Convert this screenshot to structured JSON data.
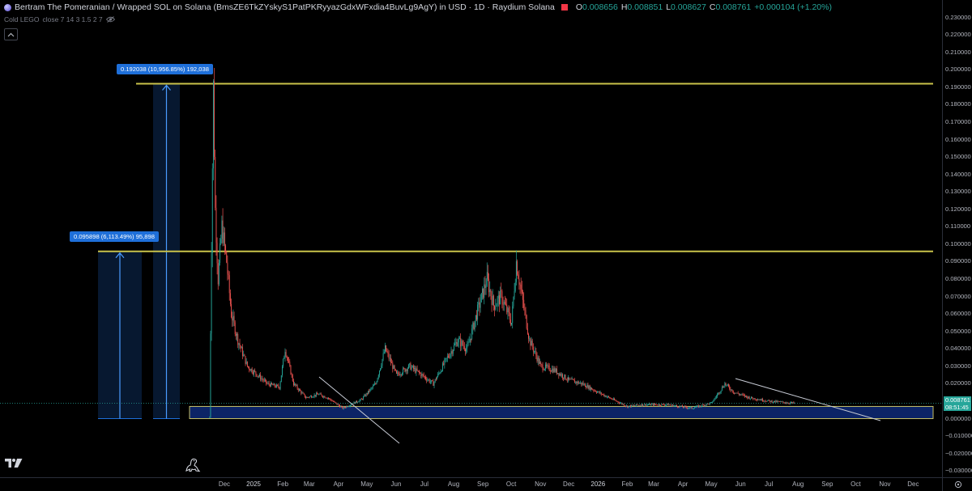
{
  "legend": {
    "title": "Bertram The Pomeranian / Wrapped SOL on Solana (BmsZE6TkZYskyS1PatPKRyyazGdxWFxdia4BuvLg9AgY) in USD · 1D · Raydium Solana",
    "open_key": "O",
    "open": "0.008656",
    "high_key": "H",
    "high": "0.008851",
    "low_key": "L",
    "low": "0.008627",
    "close_key": "C",
    "close": "0.008761",
    "change": "+0.000104 (+1.20%)",
    "flag_color": "#f23645",
    "icon": "token-logo-icon"
  },
  "indicator": {
    "name": "Cold LEGO",
    "params": "close 7 14 3 1.5 2 7",
    "visibility_icon": "eye-icon"
  },
  "colors": {
    "up": "#26a69a",
    "down": "#ef5350",
    "level_line": "#c9c24a",
    "measure_blue": "#1e6fd9",
    "zone_fill": "#0c2466",
    "trendline": "#c8ccd6"
  },
  "measurements": [
    {
      "label": "0.192038 (10,956.85%) 192,038"
    },
    {
      "label": "0.095898 (6,113.49%) 95,898"
    }
  ],
  "price_axis": {
    "ticks": [
      "0.230000",
      "0.220000",
      "0.210000",
      "0.200000",
      "0.190000",
      "0.180000",
      "0.170000",
      "0.160000",
      "0.150000",
      "0.140000",
      "0.130000",
      "0.120000",
      "0.110000",
      "0.100000",
      "0.090000",
      "0.080000",
      "0.070000",
      "0.060000",
      "0.050000",
      "0.040000",
      "0.030000",
      "0.020000",
      "0.010000",
      "0.000000",
      "−0.010000",
      "−0.020000",
      "−0.030000"
    ],
    "last_price": "0.008761",
    "countdown": "08:51:45"
  },
  "time_axis": {
    "ticks": [
      "Dec",
      "2025",
      "Feb",
      "Mar",
      "Apr",
      "May",
      "Jun",
      "Jul",
      "Aug",
      "Sep",
      "Oct",
      "Nov",
      "Dec",
      "2026",
      "Feb",
      "Mar",
      "Apr",
      "May",
      "Jun",
      "Jul",
      "Aug",
      "Sep",
      "Oct",
      "Nov",
      "Dec"
    ]
  },
  "chart_data": {
    "type": "candlestick",
    "title": "Bertram The Pomeranian / Wrapped SOL on Solana (BmsZE6TkZYskyS1PatPKRyyazGdxWFxdia4BuvLg9AgY) in USD · 1D · Raydium Solana",
    "x_start": "2024-11-15",
    "x_end": "2026-12-31",
    "interval": "1D",
    "ylim": [
      -0.03,
      0.235
    ],
    "price_anchors": [
      [
        "2024-11-15",
        0.0007
      ],
      [
        "2024-11-17",
        0.1
      ],
      [
        "2024-11-19",
        0.19
      ],
      [
        "2024-11-21",
        0.12
      ],
      [
        "2024-11-24",
        0.08
      ],
      [
        "2024-11-28",
        0.11
      ],
      [
        "2024-12-03",
        0.09
      ],
      [
        "2024-12-08",
        0.06
      ],
      [
        "2024-12-15",
        0.045
      ],
      [
        "2024-12-25",
        0.03
      ],
      [
        "2025-01-05",
        0.025
      ],
      [
        "2025-01-15",
        0.02
      ],
      [
        "2025-01-28",
        0.018
      ],
      [
        "2025-02-03",
        0.04
      ],
      [
        "2025-02-12",
        0.02
      ],
      [
        "2025-02-25",
        0.012
      ],
      [
        "2025-03-10",
        0.014
      ],
      [
        "2025-03-20",
        0.012
      ],
      [
        "2025-04-05",
        0.006
      ],
      [
        "2025-04-25",
        0.011
      ],
      [
        "2025-05-10",
        0.02
      ],
      [
        "2025-05-20",
        0.04
      ],
      [
        "2025-06-01",
        0.025
      ],
      [
        "2025-06-15",
        0.03
      ],
      [
        "2025-06-28",
        0.025
      ],
      [
        "2025-07-10",
        0.02
      ],
      [
        "2025-07-25",
        0.035
      ],
      [
        "2025-08-05",
        0.045
      ],
      [
        "2025-08-15",
        0.04
      ],
      [
        "2025-08-25",
        0.06
      ],
      [
        "2025-09-05",
        0.08
      ],
      [
        "2025-09-12",
        0.065
      ],
      [
        "2025-09-20",
        0.07
      ],
      [
        "2025-10-01",
        0.055
      ],
      [
        "2025-10-06",
        0.09
      ],
      [
        "2025-10-12",
        0.07
      ],
      [
        "2025-10-20",
        0.045
      ],
      [
        "2025-11-01",
        0.03
      ],
      [
        "2025-11-15",
        0.028
      ],
      [
        "2025-12-01",
        0.022
      ],
      [
        "2025-12-15",
        0.02
      ],
      [
        "2026-01-01",
        0.015
      ],
      [
        "2026-01-20",
        0.01
      ],
      [
        "2026-02-01",
        0.007
      ],
      [
        "2026-02-15",
        0.008
      ],
      [
        "2026-03-15",
        0.008
      ],
      [
        "2026-04-10",
        0.006
      ],
      [
        "2026-05-01",
        0.009
      ],
      [
        "2026-05-15",
        0.02
      ],
      [
        "2026-05-25",
        0.015
      ],
      [
        "2026-06-10",
        0.012
      ],
      [
        "2026-07-01",
        0.01
      ],
      [
        "2026-07-28",
        0.0088
      ]
    ],
    "horizontal_levels": [
      0.192038,
      0.095898
    ],
    "measure_base": 0.0,
    "support_zone": [
      0.0,
      0.007
    ]
  }
}
